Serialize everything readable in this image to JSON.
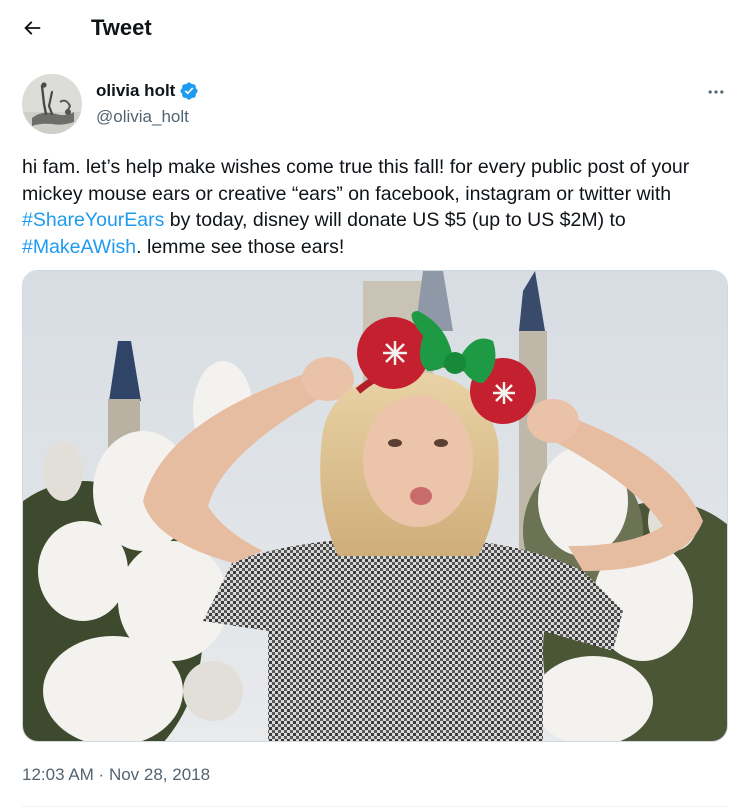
{
  "header": {
    "title": "Tweet",
    "back_icon": "arrow-left-icon"
  },
  "author": {
    "display_name": "olivia holt",
    "handle": "@olivia_holt",
    "verified": true,
    "verified_color": "#1d9bf0"
  },
  "tweet": {
    "text_parts": {
      "p1": "hi fam. let’s help make wishes come true this fall! for every public post of your mickey mouse ears or creative “ears” on facebook, instagram or twitter with ",
      "h1": "#ShareYourEars",
      "p2": " by today, disney will donate US $5 (up to US $2M) to ",
      "h2": "#MakeAWish",
      "p3": ". lemme see those ears!"
    },
    "hashtag_color": "#1d9bf0"
  },
  "meta": {
    "time": "12:03 AM",
    "separator": " · ",
    "date": "Nov 28, 2018"
  }
}
